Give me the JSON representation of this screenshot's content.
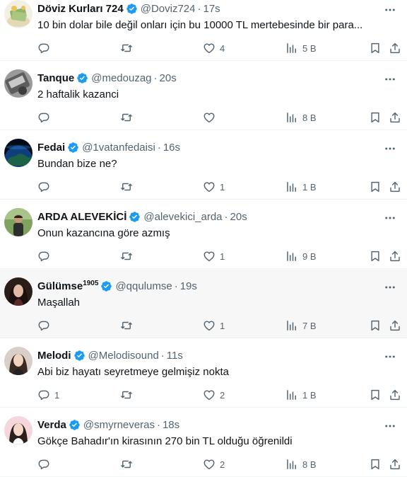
{
  "accent": "#1d9bf0",
  "tweets": [
    {
      "name": "Döviz Kurları 724",
      "name_sup": "",
      "handle": "@Doviz724",
      "dot": "·",
      "time": "17s",
      "text": "10 bin dolar bile değil onları için bu 10000 TL mertebesinde bir para...",
      "replies": "",
      "retweets": "",
      "likes": "4",
      "views": "5 B",
      "highlighted": false,
      "avatar": "money"
    },
    {
      "name": "Tanque",
      "name_sup": "",
      "handle": "@medouzag",
      "dot": "·",
      "time": "20s",
      "text": "2 haftalik kazanci",
      "replies": "",
      "retweets": "",
      "likes": "",
      "views": "8 B",
      "highlighted": false,
      "avatar": "grey"
    },
    {
      "name": "Fedai",
      "name_sup": "",
      "handle": "@1vatanfedaisi",
      "dot": "·",
      "time": "16s",
      "text": "Bundan bize ne?",
      "replies": "",
      "retweets": "",
      "likes": "1",
      "views": "1 B",
      "highlighted": false,
      "avatar": "earth"
    },
    {
      "name": "ARDA ALEVEKİCİ",
      "name_sup": "",
      "handle": "@alevekici_arda",
      "dot": "·",
      "time": "20s",
      "text": "Onun kazancına göre azmış",
      "replies": "",
      "retweets": "",
      "likes": "1",
      "views": "9 B",
      "highlighted": false,
      "avatar": "person-outdoor"
    },
    {
      "name": "Gülümse",
      "name_sup": "1905",
      "handle": "@qqulumse",
      "dot": "·",
      "time": "19s",
      "text": "Maşallah",
      "replies": "",
      "retweets": "",
      "likes": "1",
      "views": "7 B",
      "highlighted": true,
      "avatar": "woman-dark"
    },
    {
      "name": "Melodi",
      "name_sup": "",
      "handle": "@Melodisound",
      "dot": "·",
      "time": "11s",
      "text": "Abi biz hayatı seyretmeye gelmişiz nokta",
      "replies": "1",
      "retweets": "",
      "likes": "2",
      "views": "1 B",
      "highlighted": false,
      "avatar": "woman-light"
    },
    {
      "name": "Verda",
      "name_sup": "",
      "handle": "@smyrneveras",
      "dot": "·",
      "time": "18s",
      "text": "Gökçe Bahadır'ın kirasının 270 bin TL olduğu öğrenildi",
      "replies": "",
      "retweets": "",
      "likes": "2",
      "views": "8 B",
      "highlighted": false,
      "avatar": "woman-pink"
    }
  ]
}
